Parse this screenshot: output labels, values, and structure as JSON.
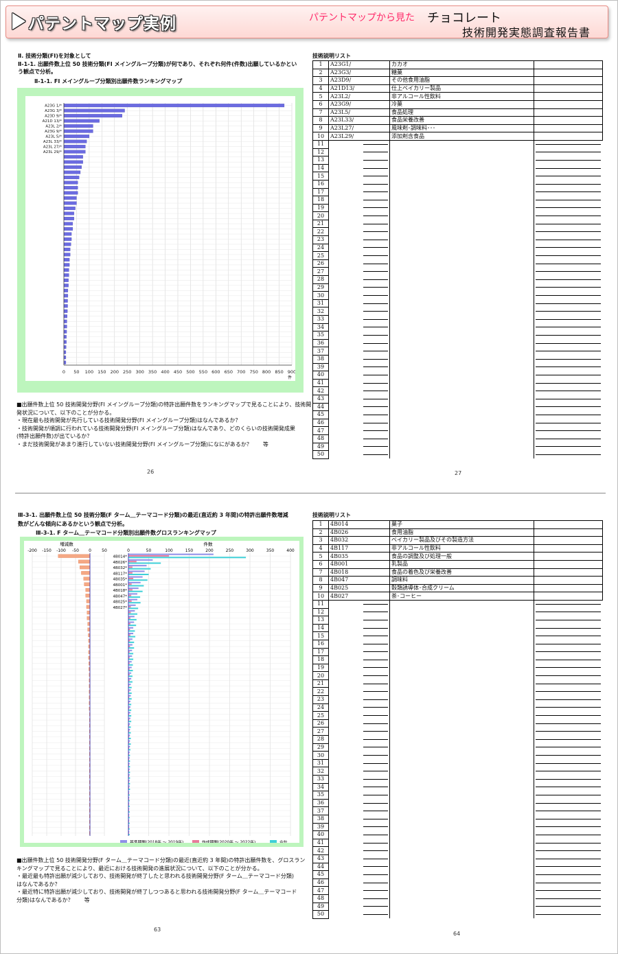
{
  "banner": {
    "title": "パテントマップ実例",
    "subtitle": "パテントマップから見た",
    "product": "チョコレート",
    "report": "技術開発実態調査報告書"
  },
  "section1": {
    "heading": "Ⅱ. 技術分類(FI)を対象として",
    "para_line1": "Ⅱ-1-1. 出願件数上位 50 技術分類(FI メイングループ分類)が何であり、それぞれ何件(件数)出願しているかとい",
    "para_line2": "う観点で分析。",
    "map_title": "Ⅱ-1-1. FI メイングループ分類別出願件数ランキングマップ",
    "notes": [
      "■出願件数上位 50 技術開発分野(FI メイングループ分類)の特許出願件数をランキングマップで見ることにより、技術開",
      "  発状況について、以下のことが分かる。",
      "  ・現在最も技術開発が先行している技術開発分野(FI メイングループ分類)はなんであるか？",
      "  ・技術開発が順調に行われている技術開発分野(FI メイングループ分類)はなんであり、どのくらいの技術開発成果",
      "   (特許出願件数)が出ているか？",
      "  ・まだ技術開発があまり進行していない技術開発分野(FI メイングループ分類)になにがあるか？　　等"
    ],
    "page_left": "26",
    "page_right": "27"
  },
  "section2": {
    "para_line1": "Ⅲ-3-1. 出願件数上位 50 技術分類(F ターム＿テーマコード分類)の最近(直近約 3 年間)の特許出願件数増減",
    "para_line2": "数がどんな傾向にあるかという観点で分析。",
    "map_title": "Ⅲ-3-1. F ターム＿テーマコード分類別出願件数グロスランキングマップ",
    "notes": [
      "■出願件数上位 50 技術開発分野(F ターム＿テーマコード分類)の最近(直近約 3 年間)の特許出願件数を、グロスラン",
      "  キングマップで見ることにより、最近における技術開発の進展状況について、以下のことが分かる。",
      "  ・最近最も特許出願が減少しており、技術開発が終了したと思われる技術開発分野(F ターム＿テーマコード分類)",
      "   はなんであるか？",
      "  ・最近特に特許出願が減少しており、技術開発が終了しつつあると思われる技術開発分野(F ターム＿テーマコード",
      "   分類)はなんであるか？　　等"
    ],
    "page_left": "63",
    "page_right": "64"
  },
  "table1": {
    "title": "技術説明リスト",
    "rows": [
      [
        "1",
        "A23G1/",
        "カカオ"
      ],
      [
        "2",
        "A23G3/",
        "糖菓"
      ],
      [
        "3",
        "A23D9/",
        "その他食用油脂"
      ],
      [
        "4",
        "A21D13/",
        "仕上ベイカリー製品"
      ],
      [
        "5",
        "A23L2/",
        "非アルコール性飲料"
      ],
      [
        "6",
        "A23G9/",
        "冷菓"
      ],
      [
        "7",
        "A23L5/",
        "食品処理"
      ],
      [
        "8",
        "A23L33/",
        "食品栄養改善"
      ],
      [
        "9",
        "A23L27/",
        "風味剤･調味料･･･"
      ],
      [
        "10",
        "A23L29/",
        "添加剤含食品"
      ]
    ]
  },
  "table2": {
    "title": "技術説明リスト",
    "rows": [
      [
        "1",
        "4B014",
        "菓子"
      ],
      [
        "2",
        "4B026",
        "食用油脂"
      ],
      [
        "3",
        "4B032",
        "ベイカリー製品及びその製造方法"
      ],
      [
        "4",
        "4B117",
        "非アルコール性飲料"
      ],
      [
        "5",
        "4B035",
        "食品の調整及び処理一般"
      ],
      [
        "6",
        "4B001",
        "乳製品"
      ],
      [
        "7",
        "4B018",
        "食品の着色及び栄養改善"
      ],
      [
        "8",
        "4B047",
        "調味料"
      ],
      [
        "9",
        "4B025",
        "穀類誘導体･合成クリーム"
      ],
      [
        "10",
        "4B027",
        "茶･コーヒー"
      ]
    ]
  },
  "chart_data": [
    {
      "type": "bar",
      "orientation": "horizontal",
      "categories": [
        "A23G 1/*",
        "A23G 3/*",
        "A23D 9/*",
        "A21D 13/*",
        "A23L 2/*",
        "A23G 9/*",
        "A23L 5/*",
        "A23L 33/*",
        "A23L 27/*",
        "A23L 29/*"
      ],
      "values": [
        870,
        240,
        230,
        140,
        115,
        115,
        100,
        90,
        85,
        85,
        75,
        75,
        70,
        65,
        60,
        55,
        55,
        55,
        50,
        50,
        45,
        40,
        40,
        35,
        35,
        30,
        30,
        28,
        25,
        25,
        22,
        22,
        20,
        20,
        18,
        18,
        16,
        16,
        15,
        15,
        14,
        13,
        12,
        12,
        11,
        10,
        10,
        9,
        8,
        8,
        8
      ],
      "xticks": [
        0,
        50,
        100,
        150,
        200,
        250,
        300,
        350,
        400,
        450,
        500,
        550,
        600,
        650,
        700,
        750,
        800,
        850,
        900
      ],
      "xlim": [
        0,
        900
      ],
      "xunit": "件",
      "color": "#6b6be0"
    },
    {
      "type": "bar",
      "orientation": "horizontal",
      "categories": [
        "4B014*",
        "4B026*",
        "4B032*",
        "4B117*",
        "4B035*",
        "4B001*",
        "4B018*",
        "4B047*",
        "4B025*",
        "4B027*"
      ],
      "left_axis_label": "増減数",
      "right_axis_label": "件数",
      "left_xticks": [
        -200,
        -150,
        -100,
        -50,
        0,
        50
      ],
      "left_xlim": [
        -200,
        50
      ],
      "right_xticks": [
        0,
        50,
        100,
        150,
        200,
        250,
        300,
        350,
        400
      ],
      "right_xlim": [
        0,
        400
      ],
      "change_values": [
        -110,
        -40,
        -35,
        -30,
        -22,
        -20,
        -15,
        -15,
        -12,
        -12,
        -10,
        -10,
        -8,
        -8,
        -6,
        -5,
        -5,
        -5,
        -5,
        -4,
        -4,
        -3,
        -3,
        -3,
        -3,
        -3,
        -3,
        -3,
        -2,
        -2,
        -2,
        -2,
        -2,
        -2,
        -2,
        -2,
        -2,
        -2,
        -2,
        -2,
        -2,
        -2,
        -2,
        -2,
        -2,
        -2,
        -2,
        -2,
        -2,
        -2
      ],
      "series": [
        {
          "name": "基準期間(2018年 ～ 2019年)",
          "values": [
            210,
            60,
            45,
            40,
            35,
            30,
            25,
            22,
            22,
            18,
            16,
            15,
            14,
            12,
            12,
            10,
            10,
            9,
            9,
            8,
            8,
            7,
            7,
            6,
            6,
            6,
            5,
            5,
            5,
            5,
            4,
            4,
            4,
            4,
            4,
            3,
            3,
            3,
            3,
            3,
            3,
            3,
            2,
            2,
            2,
            2,
            2,
            2,
            2,
            2
          ],
          "color": "#8f8fe8"
        },
        {
          "name": "作成期間(2020年 ～ 2022年)",
          "values": [
            100,
            20,
            10,
            10,
            12,
            8,
            10,
            7,
            8,
            6,
            6,
            5,
            5,
            4,
            5,
            4,
            4,
            3,
            3,
            3,
            3,
            3,
            3,
            2,
            2,
            2,
            2,
            2,
            2,
            2,
            2,
            2,
            2,
            2,
            1,
            1,
            1,
            1,
            1,
            1,
            1,
            1,
            1,
            1,
            1,
            1,
            1,
            1,
            1,
            1
          ],
          "color": "#e87a9a"
        },
        {
          "name": "合計",
          "values": [
            290,
            80,
            55,
            50,
            47,
            38,
            35,
            29,
            30,
            24,
            22,
            20,
            19,
            16,
            17,
            14,
            14,
            12,
            12,
            11,
            11,
            10,
            10,
            8,
            8,
            8,
            7,
            7,
            7,
            7,
            6,
            6,
            6,
            6,
            5,
            4,
            4,
            4,
            4,
            4,
            4,
            4,
            3,
            3,
            3,
            3,
            3,
            3,
            3,
            3
          ],
          "color": "#3fd0d8"
        }
      ]
    }
  ]
}
